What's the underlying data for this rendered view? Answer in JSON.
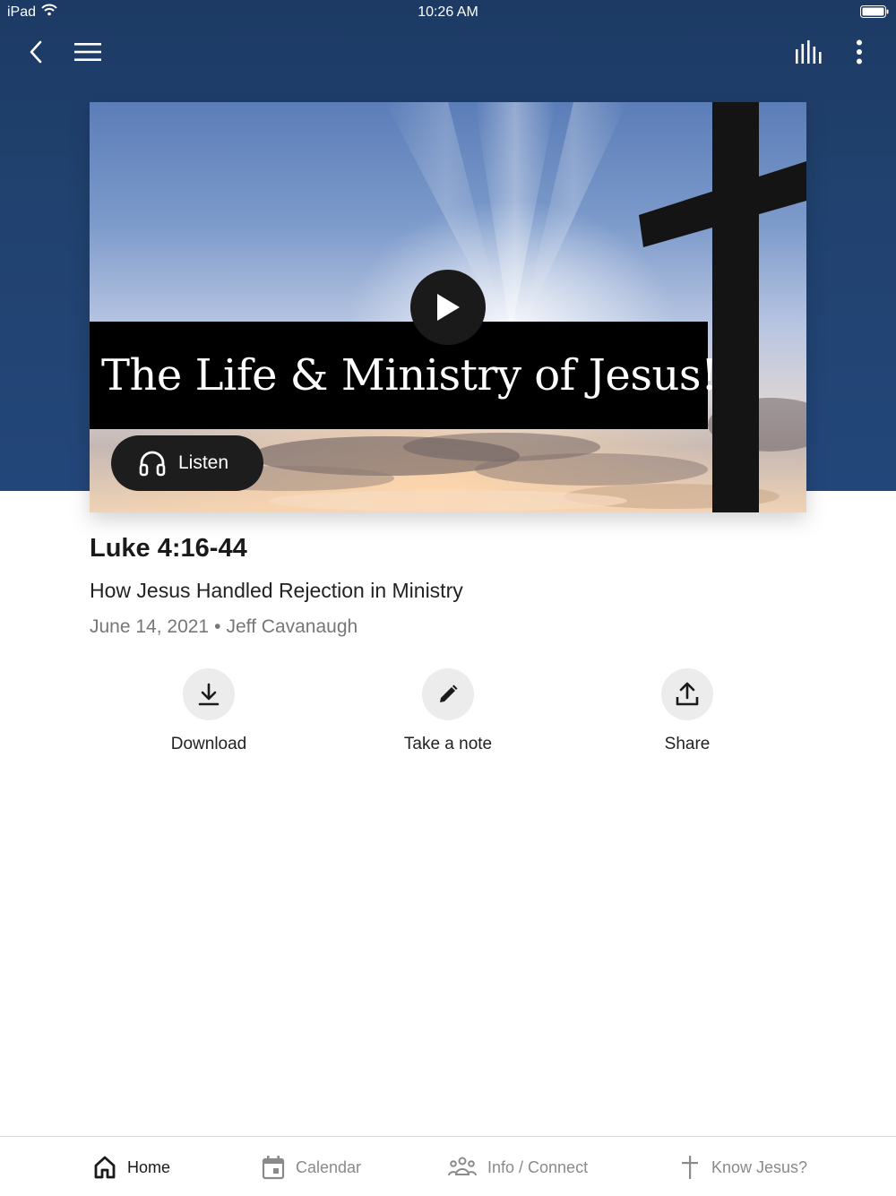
{
  "status_bar": {
    "device": "iPad",
    "time": "10:26 AM"
  },
  "hero": {
    "title": "The Life & Ministry of Jesus!",
    "listen_label": "Listen"
  },
  "sermon": {
    "scripture": "Luke 4:16-44",
    "title": "How Jesus Handled Rejection in Ministry",
    "date": "June 14, 2021",
    "separator": "•",
    "speaker": "Jeff Cavanaugh"
  },
  "actions": [
    {
      "label": "Download",
      "icon": "download-icon"
    },
    {
      "label": "Take a note",
      "icon": "pencil-icon"
    },
    {
      "label": "Share",
      "icon": "share-icon"
    }
  ],
  "tabs": [
    {
      "label": "Home",
      "icon": "home-icon",
      "active": true
    },
    {
      "label": "Calendar",
      "icon": "calendar-icon",
      "active": false
    },
    {
      "label": "Info / Connect",
      "icon": "people-icon",
      "active": false
    },
    {
      "label": "Know Jesus?",
      "icon": "cross-icon",
      "active": false
    }
  ],
  "colors": {
    "header": "#21426f",
    "button_dark": "#1d1d1d",
    "action_circle": "#ececec",
    "muted_text": "#777777"
  }
}
